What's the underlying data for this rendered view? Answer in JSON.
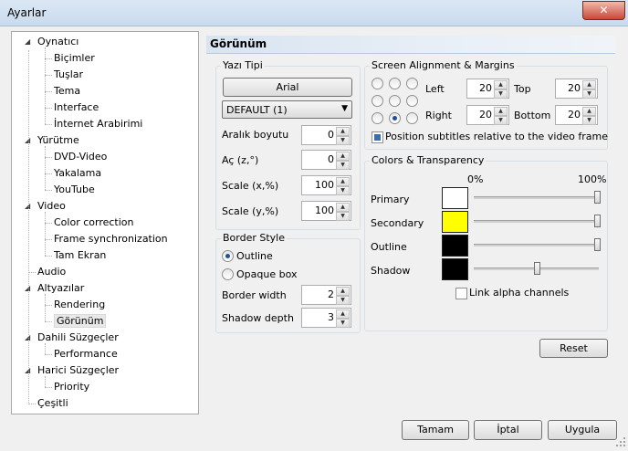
{
  "window": {
    "title": "Ayarlar",
    "close_glyph": "✕"
  },
  "tree": [
    {
      "label": "Oynatıcı",
      "level": 0,
      "toggle": "◢"
    },
    {
      "label": "Biçimler",
      "level": 1
    },
    {
      "label": "Tuşlar",
      "level": 1
    },
    {
      "label": "Tema",
      "level": 1
    },
    {
      "label": "Interface",
      "level": 1
    },
    {
      "label": "İnternet Arabirimi",
      "level": 1
    },
    {
      "label": "Yürütme",
      "level": 0,
      "toggle": "◢"
    },
    {
      "label": "DVD-Video",
      "level": 1
    },
    {
      "label": "Yakalama",
      "level": 1
    },
    {
      "label": "YouTube",
      "level": 1
    },
    {
      "label": "Video",
      "level": 0,
      "toggle": "◢"
    },
    {
      "label": "Color correction",
      "level": 1
    },
    {
      "label": "Frame synchronization",
      "level": 1
    },
    {
      "label": "Tam Ekran",
      "level": 1
    },
    {
      "label": "Audio",
      "level": 0
    },
    {
      "label": "Altyazılar",
      "level": 0,
      "toggle": "◢"
    },
    {
      "label": "Rendering",
      "level": 1
    },
    {
      "label": "Görünüm",
      "level": 1,
      "selected": true
    },
    {
      "label": "Dahili Süzgeçler",
      "level": 0,
      "toggle": "◢"
    },
    {
      "label": "Performance",
      "level": 1
    },
    {
      "label": "Harici Süzgeçler",
      "level": 0,
      "toggle": "◢"
    },
    {
      "label": "Priority",
      "level": 1
    },
    {
      "label": "Çeşitli",
      "level": 0
    }
  ],
  "panel": {
    "title": "Görünüm",
    "font_group": {
      "label": "Yazı Tipi",
      "font_button": "Arial",
      "charset_select": "DEFAULT (1)",
      "spacing": {
        "label": "Aralık boyutu",
        "value": "0"
      },
      "angle": {
        "label": "Aç (z,°)",
        "value": "0"
      },
      "scale_x": {
        "label": "Scale (x,%)",
        "value": "100"
      },
      "scale_y": {
        "label": "Scale (y,%)",
        "value": "100"
      }
    },
    "border_group": {
      "label": "Border Style",
      "outline": "Outline",
      "opaque": "Opaque box",
      "border_width": {
        "label": "Border width",
        "value": "2"
      },
      "shadow_depth": {
        "label": "Shadow depth",
        "value": "3"
      }
    },
    "align_group": {
      "label": "Screen Alignment & Margins",
      "left": {
        "label": "Left",
        "value": "20"
      },
      "top": {
        "label": "Top",
        "value": "20"
      },
      "right": {
        "label": "Right",
        "value": "20"
      },
      "bottom": {
        "label": "Bottom",
        "value": "20"
      },
      "relative_label": "Position subtitles relative to the video frame",
      "selected_position": "bottom-center"
    },
    "colors_group": {
      "label": "Colors & Transparency",
      "pct_min": "0%",
      "pct_max": "100%",
      "rows": [
        {
          "label": "Primary",
          "color": "#ffffff",
          "alpha": 1.0
        },
        {
          "label": "Secondary",
          "color": "#ffff00",
          "alpha": 1.0
        },
        {
          "label": "Outline",
          "color": "#000000",
          "alpha": 1.0
        },
        {
          "label": "Shadow",
          "color": "#000000",
          "alpha": 0.5
        }
      ],
      "link_alpha": "Link alpha channels"
    },
    "reset": "Reset"
  },
  "footer": {
    "ok": "Tamam",
    "cancel": "İptal",
    "apply": "Uygula"
  }
}
